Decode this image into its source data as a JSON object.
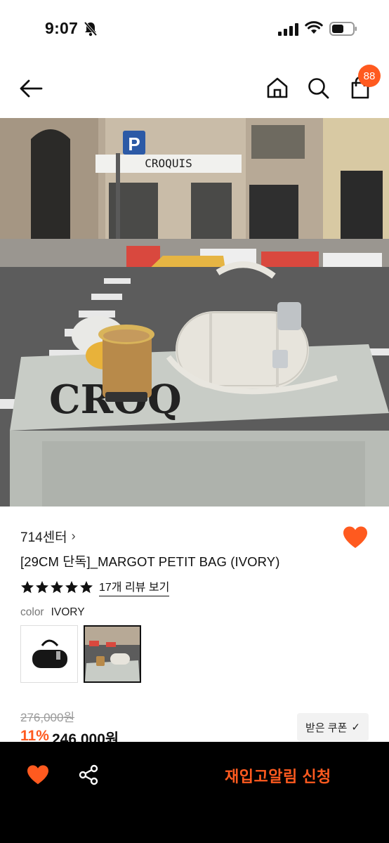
{
  "status_bar": {
    "time": "9:07"
  },
  "header": {
    "cart_count": "88"
  },
  "product": {
    "brand": "714센터",
    "brand_chevron": "›",
    "name": "[29CM 단독]_MARGOT PETIT BAG (IVORY)",
    "rating_stars": 5,
    "review_link": "17개 리뷰 보기",
    "color_label": "color",
    "color_value": "IVORY",
    "photo_signage": "CROQUIS",
    "original_price": "276,000원",
    "discount_rate": "11%",
    "sale_price": "246,000원",
    "coupon_label": "받은 쿠폰",
    "coupon_check": "✓"
  },
  "bottom_bar": {
    "restock_label": "재입고알림 신청"
  },
  "colors": {
    "accent": "#ff5a1f",
    "bottom_bar": "#000000"
  },
  "icons": [
    "back-arrow-icon",
    "home-icon",
    "search-icon",
    "shopping-bag-icon",
    "heart-icon",
    "share-icon",
    "star-icon"
  ]
}
